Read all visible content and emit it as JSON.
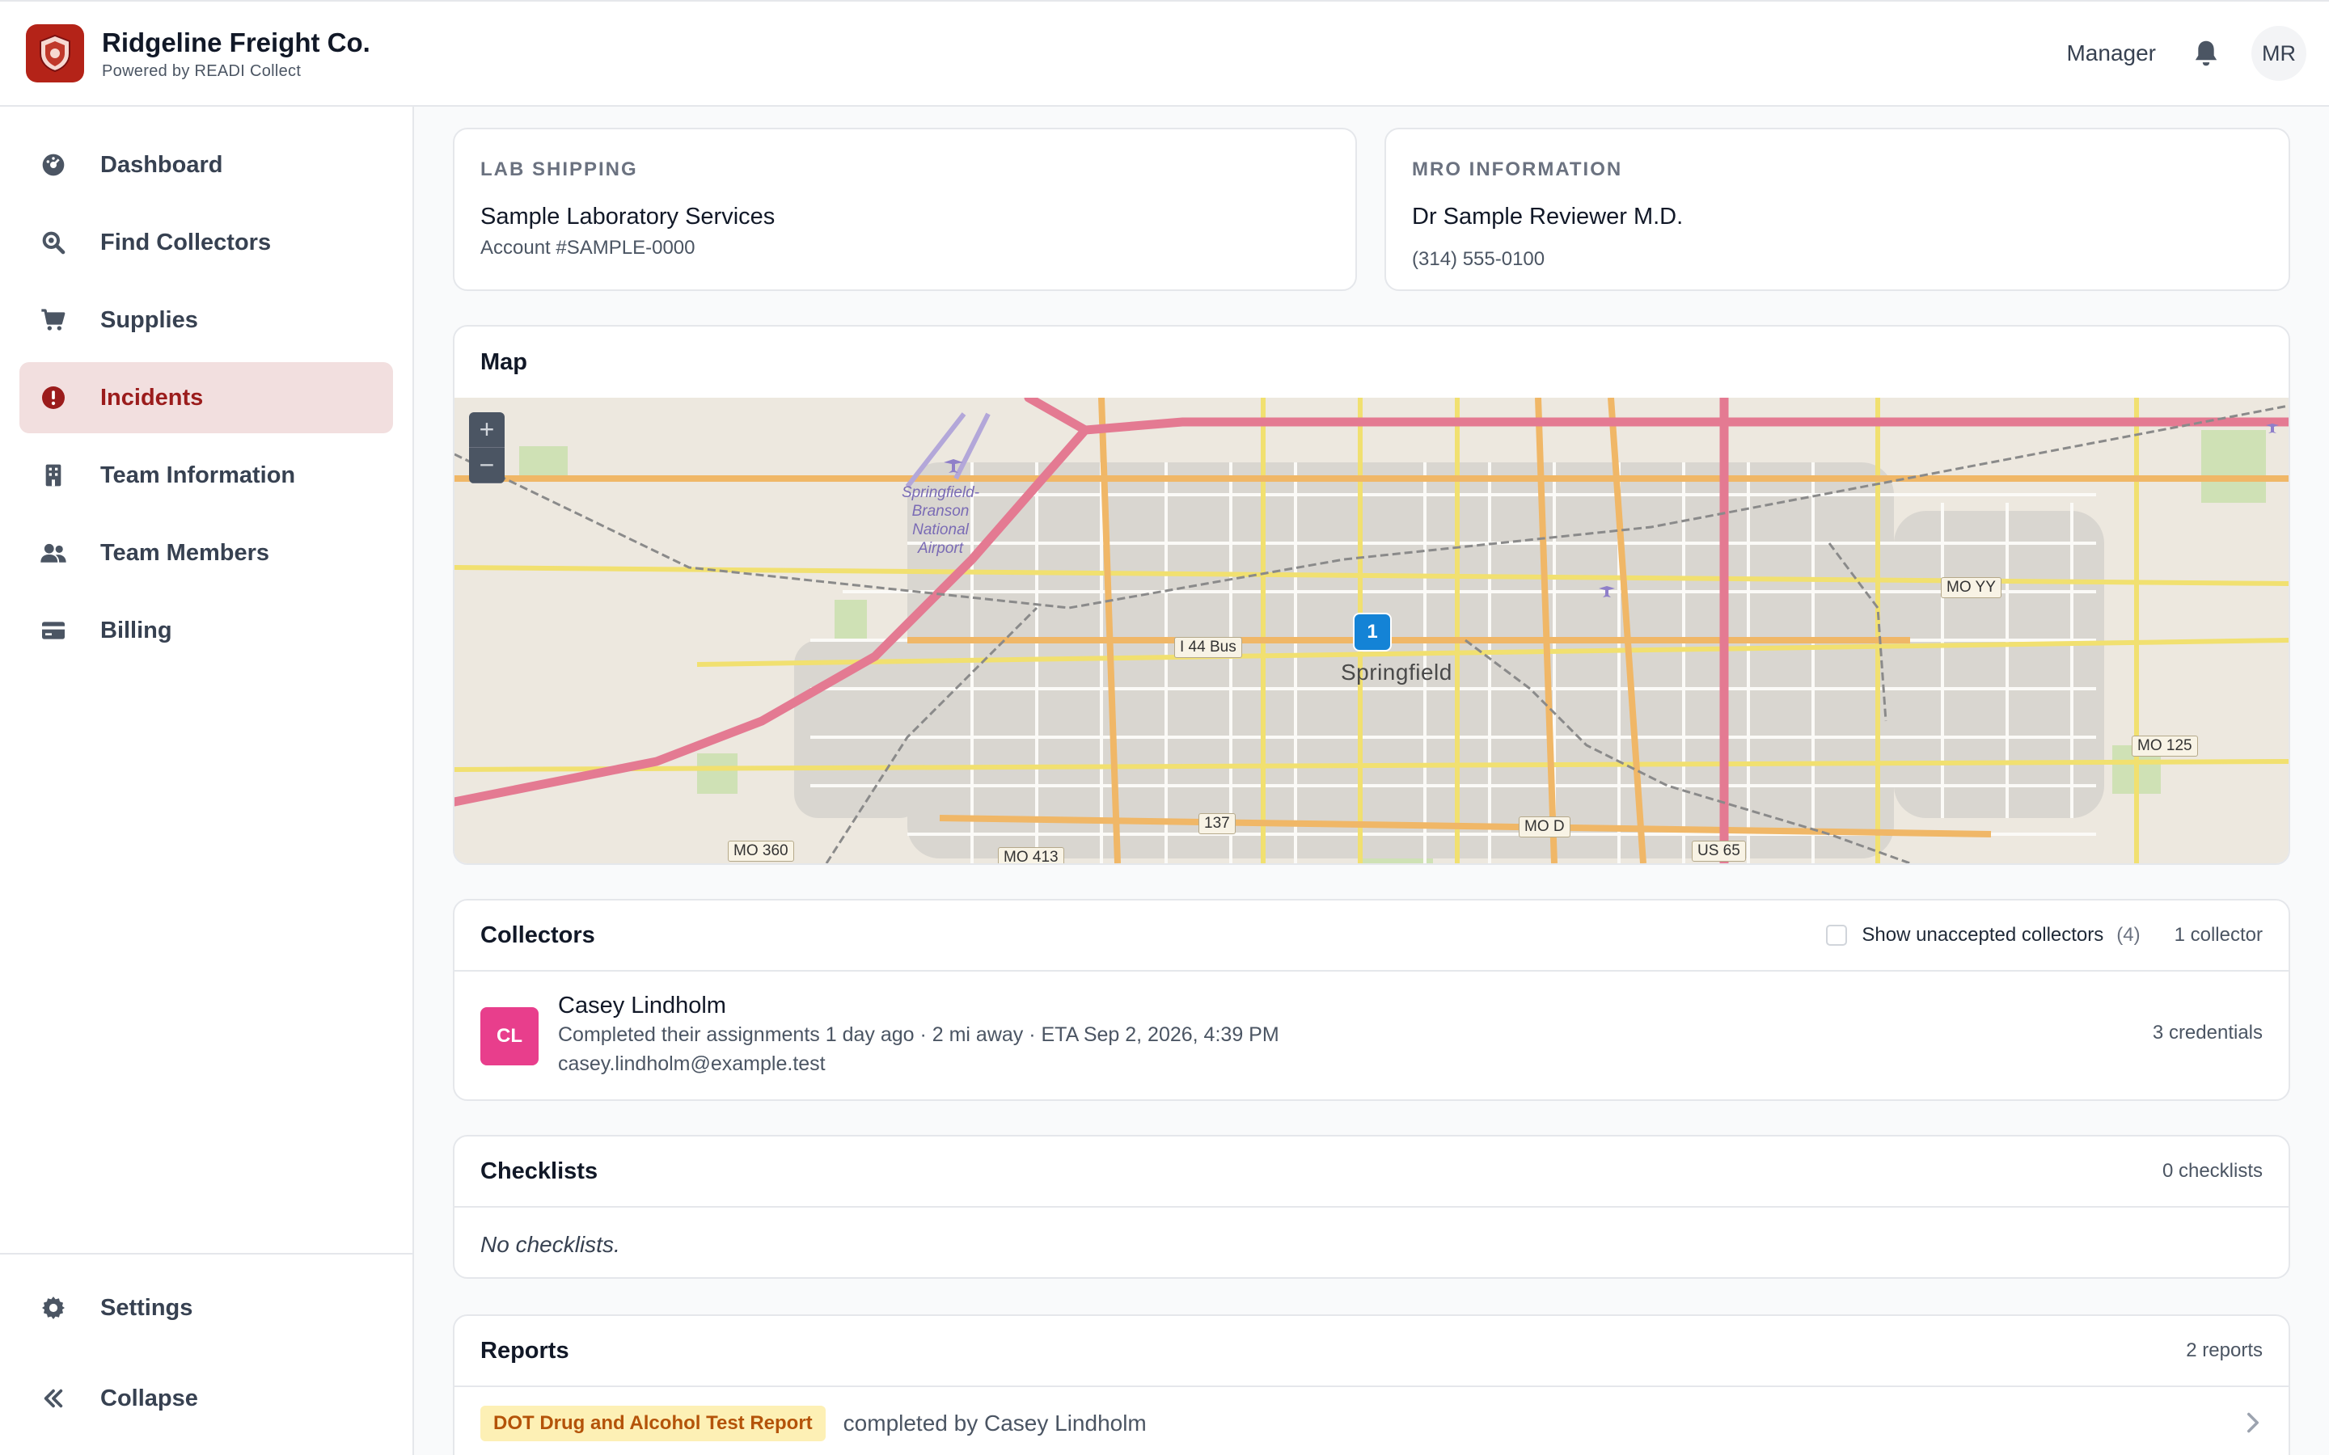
{
  "header": {
    "company_name": "Ridgeline Freight Co.",
    "powered_by": "Powered by READI Collect",
    "role": "Manager",
    "user_initials": "MR"
  },
  "sidebar": {
    "items": [
      {
        "label": "Dashboard",
        "icon": "dashboard-gauge-icon"
      },
      {
        "label": "Find Collectors",
        "icon": "search-icon"
      },
      {
        "label": "Supplies",
        "icon": "shopping-cart-icon"
      },
      {
        "label": "Incidents",
        "icon": "alert-circle-icon",
        "active": true
      },
      {
        "label": "Team Information",
        "icon": "building-icon"
      },
      {
        "label": "Team Members",
        "icon": "users-icon"
      },
      {
        "label": "Billing",
        "icon": "credit-card-icon"
      }
    ],
    "settings_label": "Settings",
    "collapse_label": "Collapse"
  },
  "lab_shipping": {
    "label": "LAB SHIPPING",
    "name": "Sample Laboratory Services",
    "account": "Account #SAMPLE-0000"
  },
  "mro": {
    "label": "MRO INFORMATION",
    "name": "Dr Sample Reviewer M.D.",
    "phone": "(314) 555-0100"
  },
  "map": {
    "title": "Map",
    "zoom_in": "+",
    "zoom_out": "−",
    "marker_count": "1",
    "city": "Springfield",
    "airport": "Springfield-Branson National Airport",
    "roads": [
      "I 44 Bus",
      "MO YY",
      "MO 125",
      "MO 360",
      "MO 413",
      "137",
      "MO D",
      "US 65"
    ]
  },
  "collectors": {
    "title": "Collectors",
    "show_unaccepted_label": "Show unaccepted collectors",
    "unaccepted_count": "(4)",
    "count_label": "1 collector",
    "items": [
      {
        "initials": "CL",
        "name": "Casey Lindholm",
        "status": "Completed their assignments 1 day ago · 2 mi away · ETA Sep 2, 2026, 4:39 PM",
        "email": "casey.lindholm@example.test",
        "credentials": "3 credentials",
        "avatar_color": "#e83e8c"
      }
    ]
  },
  "checklists": {
    "title": "Checklists",
    "count_label": "0 checklists",
    "empty_text": "No checklists."
  },
  "reports": {
    "title": "Reports",
    "count_label": "2 reports",
    "items": [
      {
        "badge": "DOT Drug and Alcohol Test Report",
        "completed_by": "completed by Casey Lindholm"
      }
    ]
  },
  "colors": {
    "brand": "#b42318",
    "active_nav_bg": "#f2dfdf",
    "active_nav_text": "#9b1c1c",
    "marker": "#1483d6",
    "badge_bg": "#fdf0b5"
  }
}
